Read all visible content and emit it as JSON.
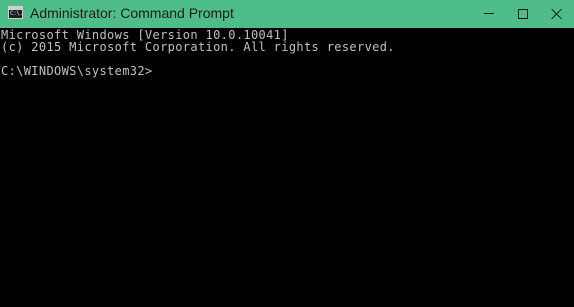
{
  "window": {
    "title": "Administrator: Command Prompt",
    "icon_glyph": "C:\\."
  },
  "colors": {
    "titlebar": "#4fbd8a",
    "console_bg": "#000000",
    "console_text": "#c0c0c0"
  },
  "icons": {
    "app": "cmd-icon",
    "minimize": "minimize-icon",
    "maximize": "maximize-icon",
    "close": "close-icon"
  },
  "console": {
    "lines": [
      "Microsoft Windows [Version 10.0.10041]",
      "(c) 2015 Microsoft Corporation. All rights reserved.",
      "",
      "C:\\WINDOWS\\system32>"
    ]
  }
}
